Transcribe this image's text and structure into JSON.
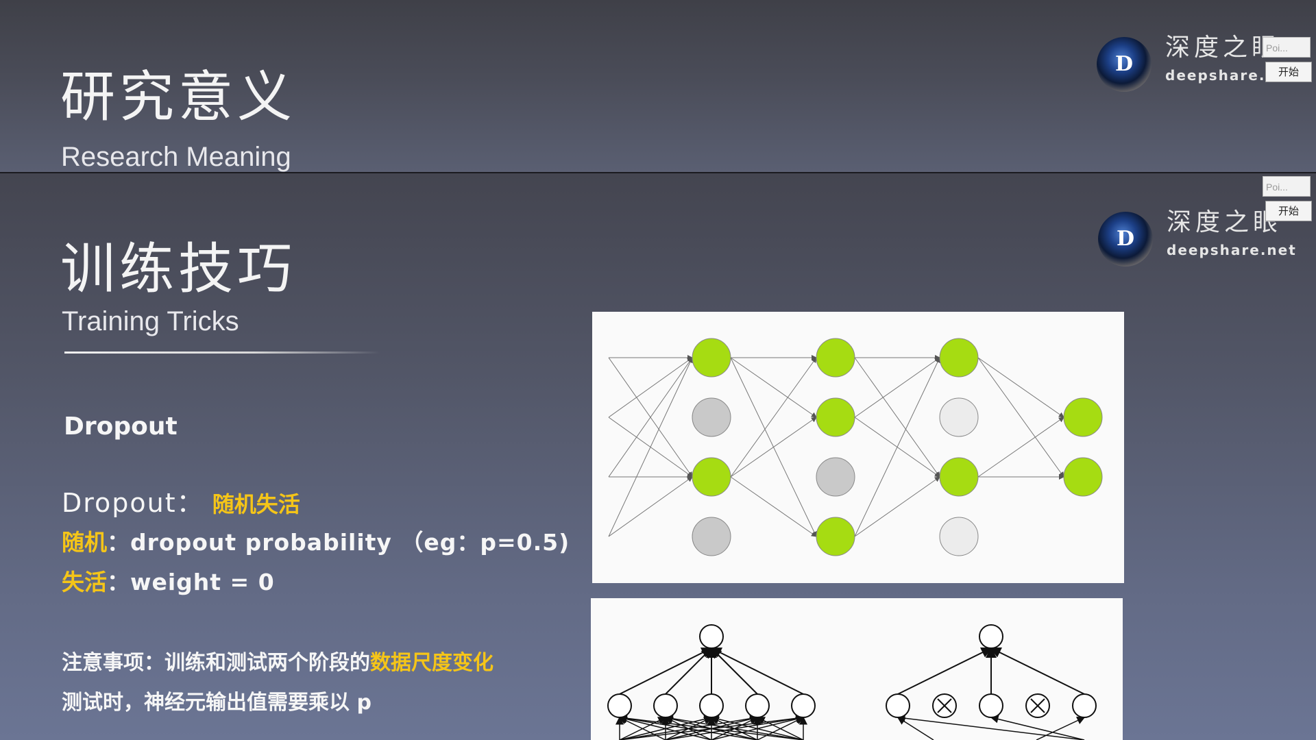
{
  "top_slide": {
    "title_cn": "研究意义",
    "title_en": "Research Meaning",
    "logo": {
      "cn": "深度之眼",
      "en": "deepshare.net",
      "mark": "D"
    },
    "widget": {
      "input_text": "Poi...",
      "button_label": "开始"
    }
  },
  "bottom_slide": {
    "title_cn": "训练技巧",
    "title_en": "Training Tricks",
    "logo": {
      "cn": "深度之眼",
      "en": "deepshare.net",
      "mark": "D"
    },
    "widget": {
      "input_text": "Poi...",
      "button_label": "开始"
    },
    "section_heading": "Dropout",
    "line1": {
      "label": "Dropout：",
      "highlight": "随机失活"
    },
    "line2": {
      "highlight": "随机",
      "text": "：dropout probability （eg：p=0.5)"
    },
    "line3": {
      "highlight": "失活",
      "text": "：weight = 0"
    },
    "note1": {
      "text": "注意事项：训练和测试两个阶段的",
      "highlight": "数据尺度变化"
    },
    "note2": {
      "text": "测试时，神经元输出值需要乘以 p"
    }
  },
  "colors": {
    "highlight": "#f5c518",
    "active_neuron": "#a6dc12",
    "dropped_neuron": "#c9c9c9",
    "inactive_neuron": "#ececec"
  },
  "diagram_top": {
    "layers": [
      {
        "nodes": [
          "active",
          "dropped",
          "active",
          "dropped"
        ]
      },
      {
        "nodes": [
          "active",
          "active",
          "dropped",
          "active"
        ]
      },
      {
        "nodes": [
          "active",
          "inactive",
          "active",
          "inactive"
        ]
      },
      {
        "nodes": [
          "active",
          "active"
        ]
      }
    ]
  },
  "diagram_bottom": {
    "left_network": {
      "hidden_nodes": 5
    },
    "right_network": {
      "hidden_nodes": [
        "kept",
        "dropped",
        "kept",
        "dropped",
        "kept"
      ]
    }
  }
}
